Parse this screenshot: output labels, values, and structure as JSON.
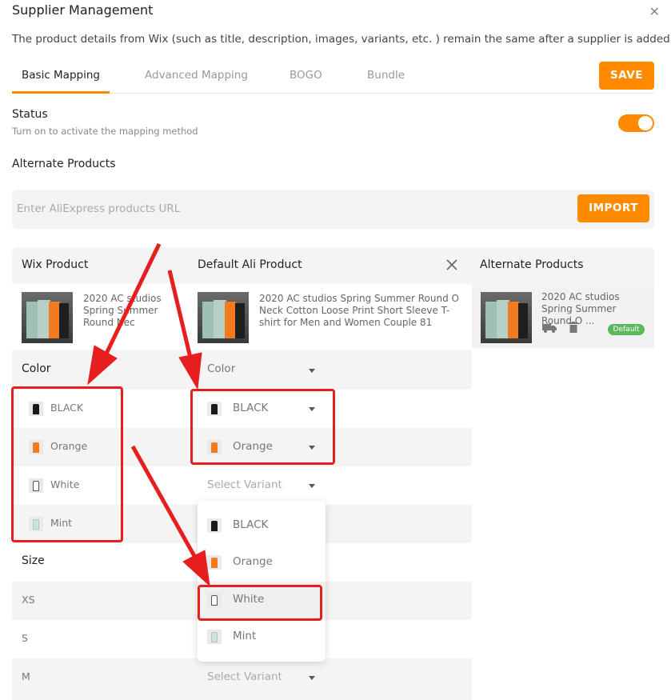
{
  "header": {
    "title": "Supplier Management",
    "description": "The product details from Wix (such as title, description, images, variants, etc. ) remain the same after a supplier is added."
  },
  "tabs": [
    "Basic Mapping",
    "Advanced Mapping",
    "BOGO",
    "Bundle"
  ],
  "save_label": "SAVE",
  "status": {
    "label": "Status",
    "hint": "Turn on to activate the mapping method",
    "enabled": true
  },
  "alternate_products_label": "Alternate Products",
  "url_input": {
    "placeholder": "Enter AliExpress products URL",
    "value": ""
  },
  "import_label": "IMPORT",
  "table": {
    "col_wix": "Wix Product",
    "col_default": "Default Ali Product",
    "col_alternate": "Alternate Products",
    "wix_product_title": "2020 AC studios Spring Summer Round Nec",
    "default_product_title": "2020 AC studios Spring Summer Round O Neck Cotton Loose Print Short Sleeve T-shirt for Men and Women Couple 81",
    "alternate_product_title": "2020 AC studios Spring Summer Round O ...",
    "alternate_default_badge": "Default",
    "color_label": "Color",
    "color_select": "Color",
    "size_label": "Size",
    "select_variant_placeholder": "Select Variant",
    "colors": [
      "BLACK",
      "Orange",
      "White",
      "Mint"
    ],
    "sizes": [
      "XS",
      "S",
      "M"
    ],
    "mapped_colors": [
      "BLACK",
      "Orange"
    ],
    "dropdown_options": [
      "BLACK",
      "Orange",
      "White",
      "Mint"
    ],
    "highlighted_option": "White"
  },
  "colors": {
    "accent": "#ff8a00",
    "annotation_red": "#e61e1e",
    "badge_green": "#5bb85d",
    "swatch_black": "#1a1a1a",
    "swatch_orange": "#f07b20",
    "swatch_white": "#ffffff",
    "swatch_mint": "#cfe3dc"
  }
}
